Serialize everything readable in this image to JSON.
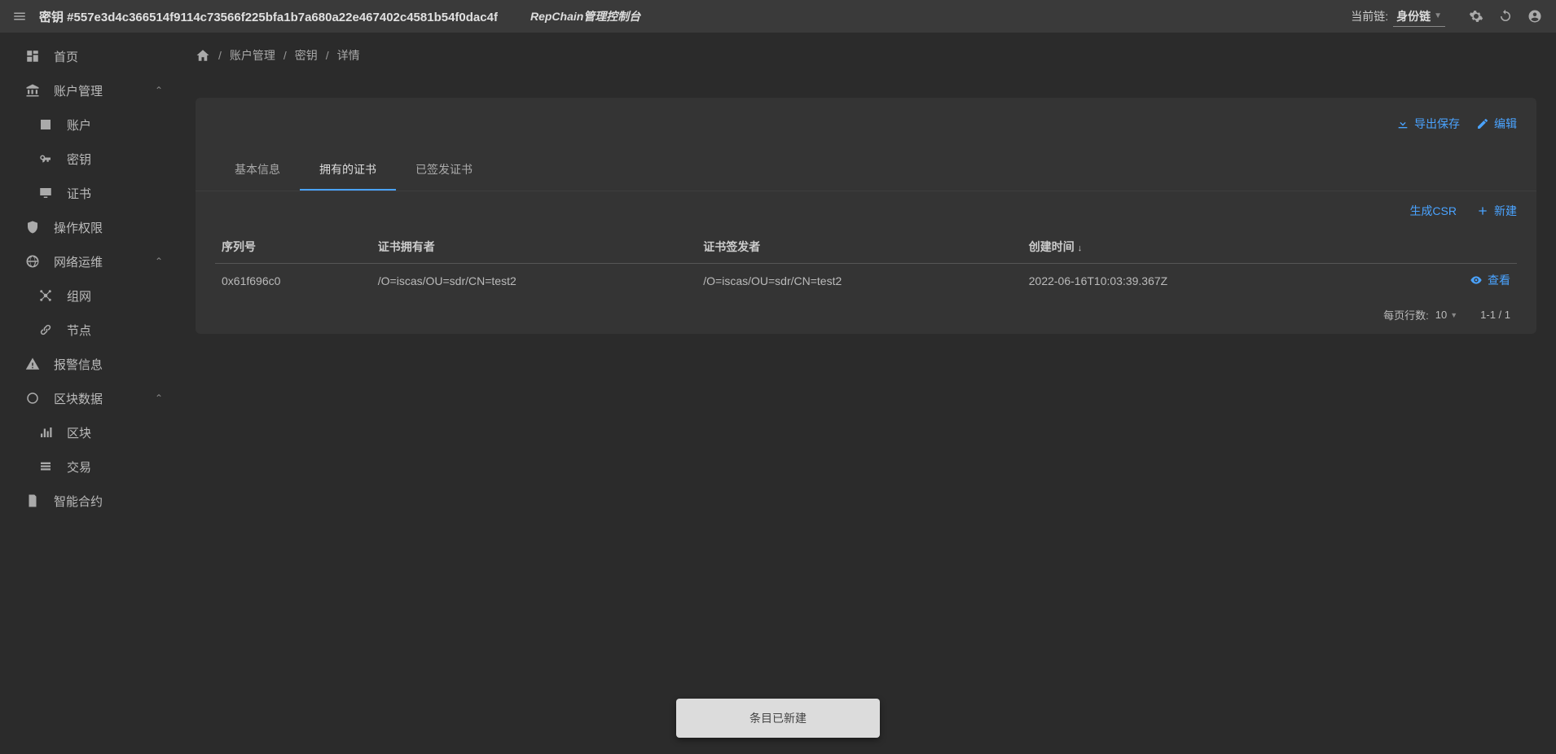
{
  "topbar": {
    "title": "密钥 #557e3d4c366514f9114c73566f225bfa1b7a680a22e467402c4581b54f0dac4f",
    "brand": "RepChain管理控制台",
    "chain_label": "当前链:",
    "chain_value": "身份链"
  },
  "sidebar": {
    "home": "首页",
    "account_mgmt": "账户管理",
    "account": "账户",
    "key": "密钥",
    "cert": "证书",
    "op_auth": "操作权限",
    "net_ops": "网络运维",
    "network": "组网",
    "node": "节点",
    "alert": "报警信息",
    "block_data": "区块数据",
    "block": "区块",
    "tx": "交易",
    "contract": "智能合约"
  },
  "crumbs": {
    "c1": "账户管理",
    "c2": "密钥",
    "c3": "详情"
  },
  "actions": {
    "export": "导出保存",
    "edit": "编辑",
    "gen_csr": "生成CSR",
    "new": "新建",
    "view": "查看"
  },
  "tabs": {
    "t1": "基本信息",
    "t2": "拥有的证书",
    "t3": "已签发证书"
  },
  "columns": {
    "serial": "序列号",
    "owner": "证书拥有者",
    "issuer": "证书签发者",
    "created": "创建时间"
  },
  "rows": [
    {
      "serial": "0x61f696c0",
      "owner": "/O=iscas/OU=sdr/CN=test2",
      "issuer": "/O=iscas/OU=sdr/CN=test2",
      "created": "2022-06-16T10:03:39.367Z"
    }
  ],
  "pager": {
    "per_page_label": "每页行数:",
    "per_page_value": "10",
    "range": "1-1 / 1"
  },
  "toast": "条目已新建"
}
